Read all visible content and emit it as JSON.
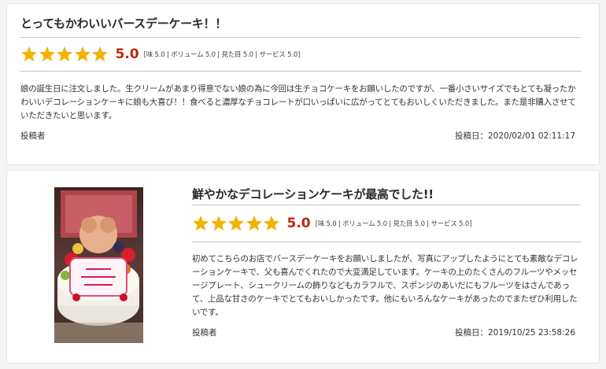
{
  "colors": {
    "star": "#f2b200",
    "score": "#c0260f"
  },
  "reviews": [
    {
      "title": "とってもかわいいバースデーケーキ！！",
      "stars": 5,
      "score": "5.0",
      "breakdown": "[味 5.0 | ボリューム 5.0 | 見た目 5.0 | サービス 5.0]",
      "body": "娘の誕生日に注文しました。生クリームがあまり得意でない娘の為に今回は生チョコケーキをお願いしたのですが、一番小さいサイズでもとても凝ったかわいいデコレーションケーキに娘も大喜び！！食べると濃厚なチョコレートが口いっぱいに広がってとてもおいしくいただきました。また是非購入させていただきたいと思います。",
      "author": "投稿者",
      "date": "投稿日：2020/02/01 02:11:17"
    },
    {
      "photo_icon": "cake-photo",
      "title": "鮮やかなデコレーションケーキが最高でした!!",
      "stars": 5,
      "score": "5.0",
      "breakdown": "[味 5.0 | ボリューム 5.0 | 見た目 5.0 | サービス 5.0]",
      "body": "初めてこちらのお店でバースデーケーキをお願いしましたが、写真にアップしたようにとても素敵なデコレーションケーキで、父も喜んでくれたので大変満足しています。ケーキの上のたくさんのフルーツやメッセージプレート、シュークリームの飾りなどもカラフルで、スポンジのあいだにもフルーツをはさんであって、上品な甘さのケーキでとてもおいしかったです。他にもいろんなケーキがあったのでまたぜひ利用したいです。",
      "author": "投稿者",
      "date": "投稿日：2019/10/25 23:58:26"
    }
  ]
}
